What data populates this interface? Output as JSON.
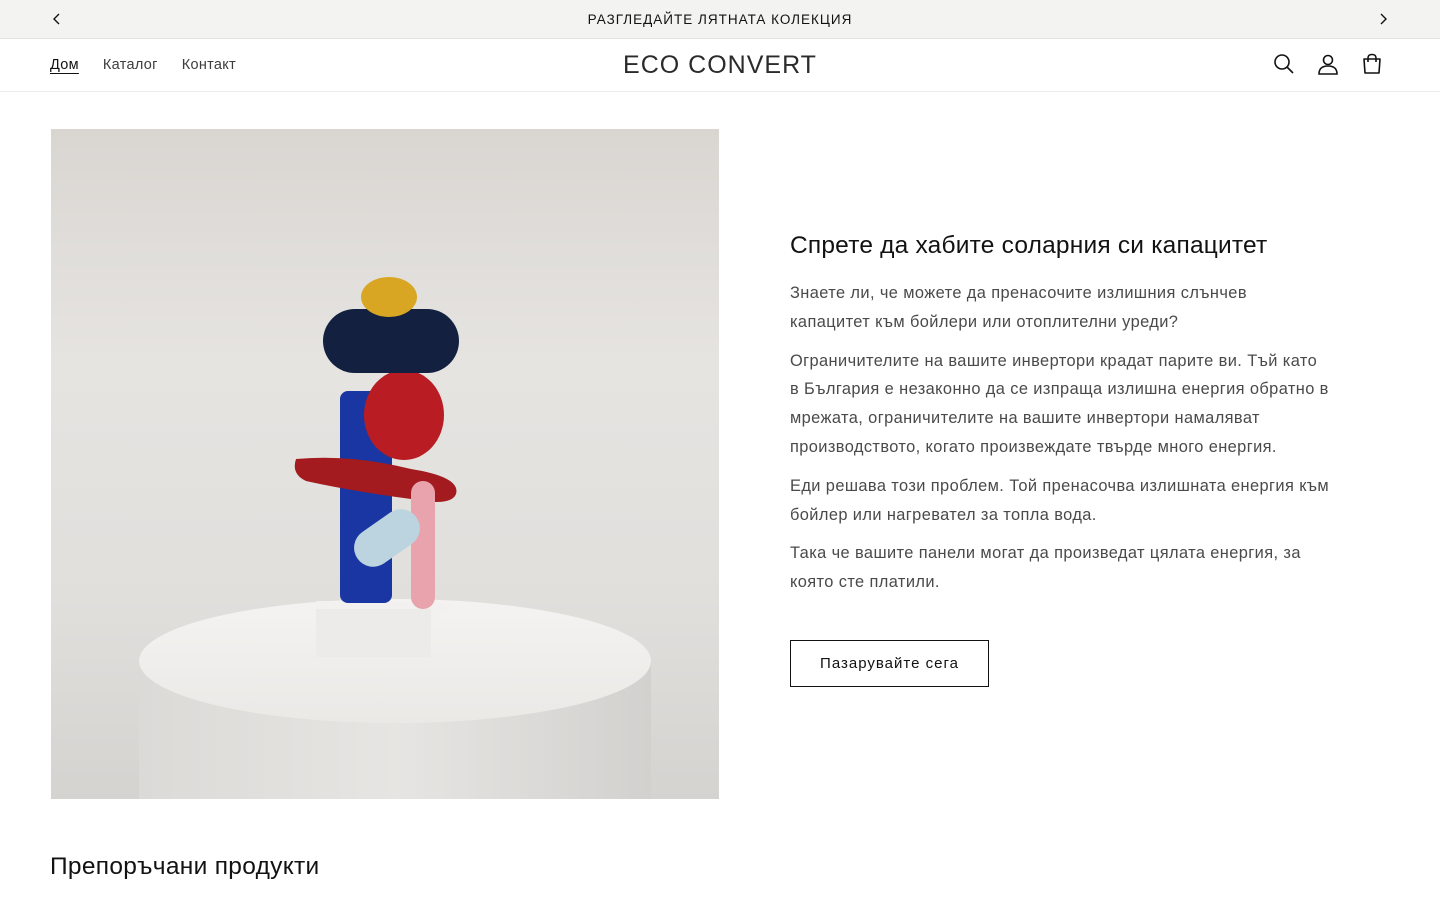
{
  "announcement": {
    "text": "РАЗГЛЕДАЙТЕ ЛЯТНАТА КОЛЕКЦИЯ",
    "prev_icon": "chevron-left-icon",
    "next_icon": "chevron-right-icon"
  },
  "header": {
    "nav": [
      {
        "label": "Дом",
        "active": true
      },
      {
        "label": "Каталог",
        "active": false
      },
      {
        "label": "Контакт",
        "active": false
      }
    ],
    "logo": "ECO CONVERT",
    "icons": [
      "search-icon",
      "account-icon",
      "cart-icon"
    ]
  },
  "hero": {
    "title": "Спрете да хабите соларния си капацитет",
    "paragraphs": [
      "Знаете ли, че можете да пренасочите излишния слънчев капацитет към бойлери или отоплителни уреди?",
      "Ограничителите на вашите инвертори крадат парите ви. Тъй като в България е незаконно да се изпраща излишна енергия обратно в мрежата, ограничителите на вашите инвертори намаляват производството, когато произвеждате твърде много енергия.",
      "Еди решава този проблем. Той пренасочва излишната енергия към бойлер или нагревател за топла вода.",
      "Така че вашите панели могат да произведат цялата енергия, за която сте платили."
    ],
    "button_label": "Пазарувайте сега"
  },
  "featured": {
    "title": "Препоръчани продукти"
  },
  "colors": {
    "announcement_bg": "#f3f3f1",
    "text": "#121212",
    "body_text": "#4a4a4a"
  }
}
